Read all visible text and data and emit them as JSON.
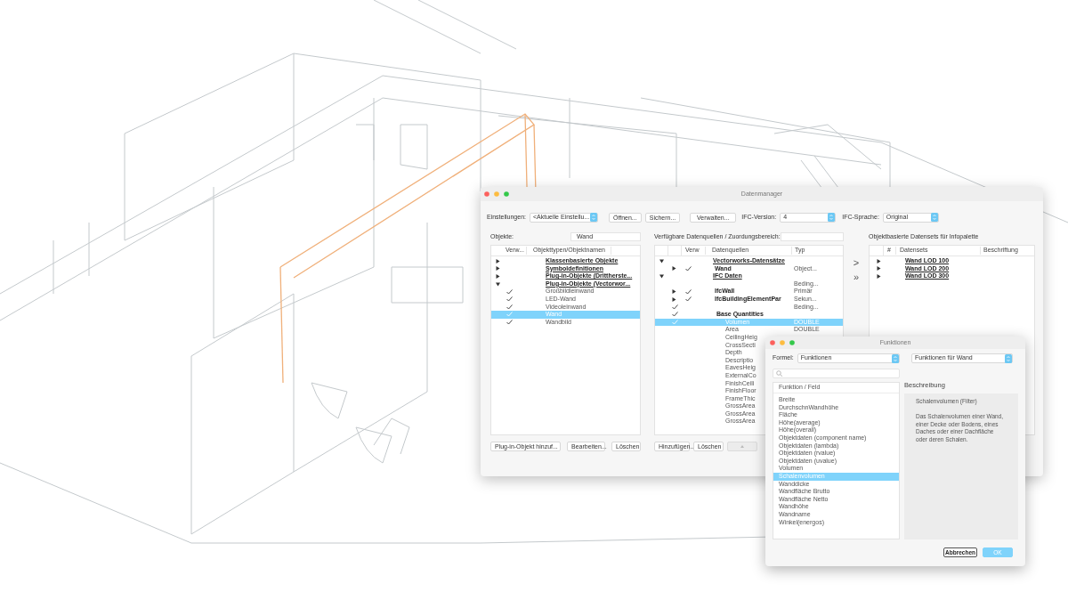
{
  "main_window": {
    "title": "Datenmanager",
    "settings": {
      "label": "Einstellungen:",
      "value": "<Aktuelle Einstellu...",
      "buttons": [
        "Öffnen...",
        "Sichern...",
        "Verwalten..."
      ],
      "ifc_version_label": "IFC-Version:",
      "ifc_version": "4",
      "ifc_language_label": "IFC-Sprache:",
      "ifc_language": "Original"
    },
    "objects_panel": {
      "label": "Objekte:",
      "search_value": "Wand",
      "columns": [
        "Verw...",
        "Objekttypen/Objektnamen"
      ],
      "tree": [
        {
          "name": "Klassenbasierte Objekte",
          "kind": "group",
          "expanded": false,
          "selected": false
        },
        {
          "name": "Symboldefinitionen",
          "kind": "group",
          "expanded": false,
          "selected": false
        },
        {
          "name": "Plug-in-Objekte (Drittherste...",
          "kind": "group",
          "expanded": false,
          "selected": false
        },
        {
          "name": "Plug-in-Objekte (Vectorwor...",
          "kind": "group",
          "expanded": true,
          "selected": false,
          "children": [
            {
              "name": "Großbildleinwand",
              "kind": "item",
              "checked": true,
              "selected": false
            },
            {
              "name": "LED-Wand",
              "kind": "item",
              "checked": true,
              "selected": false
            },
            {
              "name": "Videoleinwand",
              "kind": "item",
              "checked": true,
              "selected": false
            },
            {
              "name": "Wand",
              "kind": "item",
              "checked": true,
              "selected": true
            },
            {
              "name": "Wandbild",
              "kind": "item",
              "checked": true,
              "selected": false
            }
          ]
        }
      ],
      "buttons": [
        "Plug-in-Objekt hinzuf...",
        "Bearbeiten...",
        "Löschen"
      ]
    },
    "sources_panel": {
      "label": "Verfügbare Datenquellen / Zuordungsbereich:",
      "columns": [
        "Verw",
        "Datenquellen",
        "Typ"
      ],
      "tree": [
        {
          "name": "Vectorworks-Datensätze",
          "kind": "group",
          "expanded": true,
          "selected": false,
          "children": [
            {
              "name": "Wand",
              "kind": "section",
              "expanded": false,
              "checked": true,
              "type": "Object...",
              "selected": false
            }
          ]
        },
        {
          "name": "IFC Daten",
          "kind": "group",
          "expanded": true,
          "selected": false,
          "children": [
            {
              "type": "Beding...",
              "selected": false
            },
            {
              "name": "IfcWall",
              "kind": "section",
              "expanded": false,
              "checked": true,
              "type": "Primär",
              "selected": false
            },
            {
              "name": "IfcBuildingElementPar",
              "kind": "section",
              "expanded": false,
              "checked": true,
              "type": "Sekun...",
              "selected": false
            },
            {
              "checked": true,
              "type": "Beding...",
              "selected": false
            },
            {
              "name": "Base Quantities",
              "kind": "section",
              "checked": true,
              "selected": false,
              "children": [
                {
                  "name": "Volumen",
                  "kind": "item",
                  "checked": true,
                  "type": "DOUBLE",
                  "selected": true
                },
                {
                  "name": "Area",
                  "kind": "item",
                  "type": "DOUBLE",
                  "selected": false
                },
                {
                  "name": "CeilingHeig",
                  "kind": "item",
                  "selected": false
                },
                {
                  "name": "CrossSecti",
                  "kind": "item",
                  "selected": false
                },
                {
                  "name": "Depth",
                  "kind": "item",
                  "selected": false
                },
                {
                  "name": "Descriptio",
                  "kind": "item",
                  "selected": false
                },
                {
                  "name": "EavesHeig",
                  "kind": "item",
                  "selected": false
                },
                {
                  "name": "ExternalCo",
                  "kind": "item",
                  "selected": false
                },
                {
                  "name": "FinishCeili",
                  "kind": "item",
                  "selected": false
                },
                {
                  "name": "FinishFloor",
                  "kind": "item",
                  "selected": false
                },
                {
                  "name": "FrameThic",
                  "kind": "item",
                  "selected": false
                },
                {
                  "name": "GrossArea",
                  "kind": "item",
                  "selected": false
                },
                {
                  "name": "GrossArea",
                  "kind": "item",
                  "selected": false
                },
                {
                  "name": "GrossArea",
                  "kind": "item",
                  "selected": false
                }
              ]
            }
          ]
        }
      ],
      "buttons": [
        "Hinzufügen...",
        "Löschen"
      ],
      "up_button": {
        "disabled": true
      }
    },
    "transfer_buttons": [
      ">",
      "»"
    ],
    "datasets_panel": {
      "label": "Objektbasierte Datensets für Infopalette",
      "columns": [
        "#",
        "Datensets",
        "Beschriftung"
      ],
      "rows": [
        {
          "name": "Wand LOD 100",
          "expanded": false,
          "selected": false
        },
        {
          "name": "Wand LOD 200",
          "expanded": false,
          "selected": false
        },
        {
          "name": "Wand LOD 300",
          "expanded": false,
          "selected": false
        }
      ]
    }
  },
  "functions_window": {
    "title": "Funktionen",
    "formula_label": "Formel:",
    "formula_value": "Funktionen",
    "scope_value": "Funktionen für Wand",
    "list_header": "Funktion / Feld",
    "items": [
      {
        "label": "Breite",
        "selected": false
      },
      {
        "label": "DurchschnWandhöhe",
        "selected": false
      },
      {
        "label": "Fläche",
        "selected": false
      },
      {
        "label": "Höhe(average)",
        "selected": false
      },
      {
        "label": "Höhe(overall)",
        "selected": false
      },
      {
        "label": "Objektdaten (component name)",
        "selected": false
      },
      {
        "label": "Objektdaten (lambda)",
        "selected": false
      },
      {
        "label": "Objektdaten (rvalue)",
        "selected": false
      },
      {
        "label": "Objektdaten (uvalue)",
        "selected": false
      },
      {
        "label": "Volumen",
        "selected": false
      },
      {
        "label": "Schalenvolumen",
        "selected": true
      },
      {
        "label": "Wanddicke",
        "selected": false
      },
      {
        "label": "Wandfläche Brutto",
        "selected": false
      },
      {
        "label": "Wandfläche Netto",
        "selected": false
      },
      {
        "label": "Wandhöhe",
        "selected": false
      },
      {
        "label": "Wandname",
        "selected": false
      },
      {
        "label": "Winkel(energos)",
        "selected": false
      }
    ],
    "description_title": "Beschreibung",
    "description_heading": "Schalenvolumen (Filter)",
    "description": "Das Schalenvolumen einer Wand, einer Decke oder Bodens, eines Daches oder einer Dachfläche oder deren Schalen.",
    "buttons": [
      {
        "label": "Abbrechen",
        "kind": "default"
      },
      {
        "label": "OK",
        "kind": "primary"
      }
    ]
  }
}
